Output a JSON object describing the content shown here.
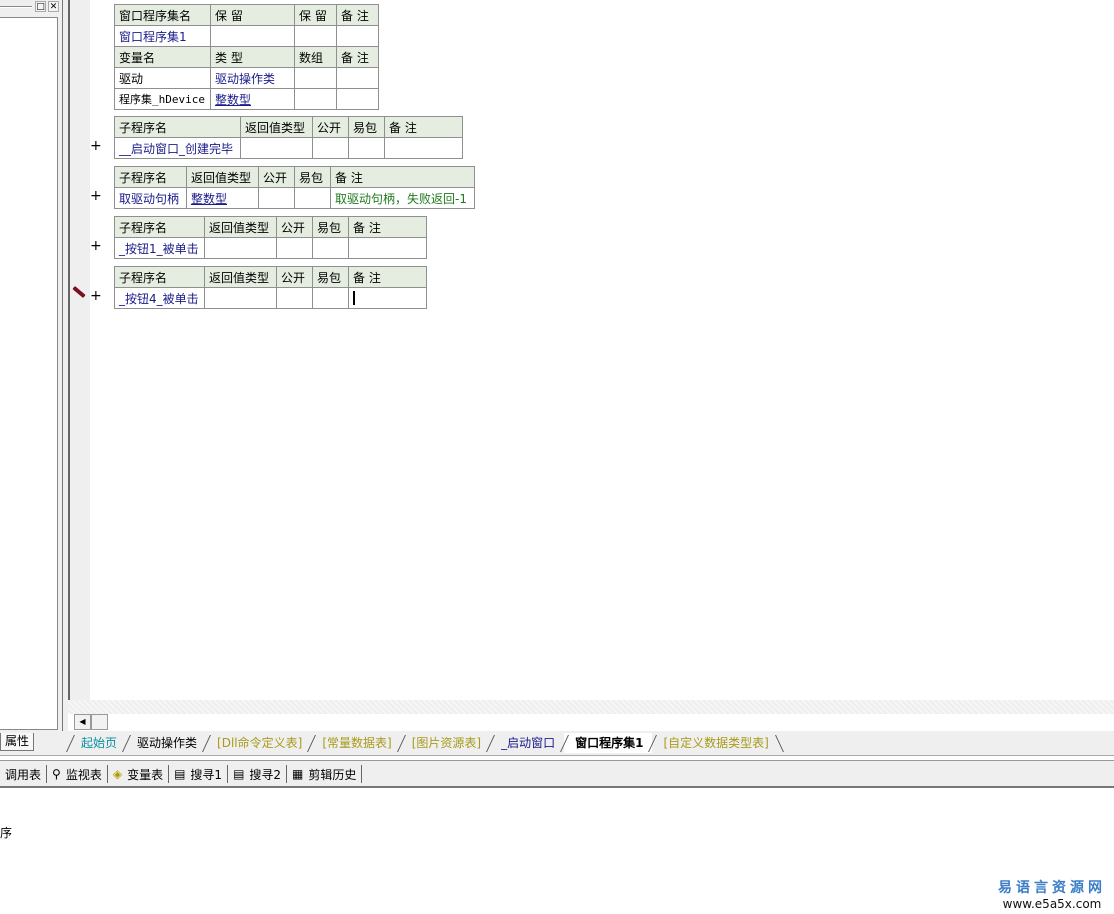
{
  "left_panel": {
    "maximize_icon": "□",
    "close_icon": "✕",
    "bottom_tab": "属性"
  },
  "assembly_table": {
    "header": [
      "窗口程序集名",
      "保 留",
      "保 留",
      "备 注"
    ],
    "row": [
      "窗口程序集1",
      "",
      "",
      ""
    ],
    "var_header": [
      "变量名",
      "类 型",
      "数组",
      "备 注"
    ],
    "vars": [
      {
        "name": "驱动",
        "type": "驱动操作类",
        "array": "",
        "note": ""
      },
      {
        "name": "程序集_hDevice",
        "type": "整数型",
        "array": "",
        "note": ""
      }
    ]
  },
  "subroutines": [
    {
      "header": [
        "子程序名",
        "返回值类型",
        "公开",
        "易包",
        "备 注"
      ],
      "name": "__启动窗口_创建完毕",
      "return_type": "",
      "public": "",
      "epkg": "",
      "note": "",
      "expand": "+"
    },
    {
      "header": [
        "子程序名",
        "返回值类型",
        "公开",
        "易包",
        "备 注"
      ],
      "name": "取驱动句柄",
      "return_type": "整数型",
      "public": "",
      "epkg": "",
      "note": "取驱动句柄，失败返回-1",
      "expand": "+"
    },
    {
      "header": [
        "子程序名",
        "返回值类型",
        "公开",
        "易包",
        "备 注"
      ],
      "name": "_按钮1_被单击",
      "return_type": "",
      "public": "",
      "epkg": "",
      "note": "",
      "expand": "+"
    },
    {
      "header": [
        "子程序名",
        "返回值类型",
        "公开",
        "易包",
        "备 注"
      ],
      "name": "_按钮4_被单击",
      "return_type": "",
      "public": "",
      "epkg": "",
      "note": "",
      "expand": "+"
    }
  ],
  "scroll": {
    "left_arrow": "◀"
  },
  "tabs": [
    {
      "label": "起始页",
      "style": "teal"
    },
    {
      "label": "驱动操作类",
      "style": "plain"
    },
    {
      "label": "[Dll命令定义表]",
      "style": "olive"
    },
    {
      "label": "[常量数据表]",
      "style": "olive"
    },
    {
      "label": "[图片资源表]",
      "style": "olive"
    },
    {
      "label": "_启动窗口",
      "style": "navy"
    },
    {
      "label": "窗口程序集1",
      "style": "active"
    },
    {
      "label": "[自定义数据类型表]",
      "style": "olive"
    }
  ],
  "bottom_tools": [
    {
      "label": "调用表",
      "icon": ""
    },
    {
      "label": "监视表",
      "icon": "🔍"
    },
    {
      "label": "变量表",
      "icon": "◈"
    },
    {
      "label": "搜寻1",
      "icon": "▤"
    },
    {
      "label": "搜寻2",
      "icon": "▤"
    },
    {
      "label": "剪辑历史",
      "icon": "▦"
    }
  ],
  "output": {
    "text": "序"
  },
  "watermark": {
    "title": "易语言资源网",
    "url": "www.e5a5x.com"
  }
}
